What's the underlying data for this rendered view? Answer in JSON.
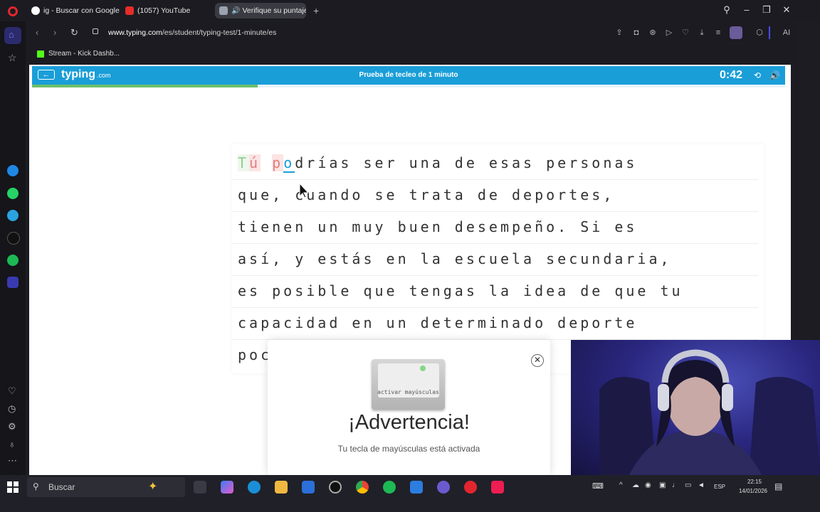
{
  "browser": {
    "tabs": [
      {
        "label": "ig - Buscar con Google",
        "icon": "google-icon"
      },
      {
        "label": "(1057) YouTube",
        "icon": "youtube-icon"
      },
      {
        "label": "Verifique su puntaje d",
        "icon": "speaker-icon"
      }
    ],
    "url_domain": "www.typing.com",
    "url_path": "/es/student/typing-test/1-minute/es",
    "bookmark": "Stream - Kick Dashb...",
    "toolbar_ai": "AI"
  },
  "page": {
    "logo": "typing",
    "logo_suffix": ".com",
    "title": "Prueba de tecleo de 1 minuto",
    "timer": "0:42",
    "progress_fraction": 0.3,
    "lines": [
      "que, cuando se trata de deportes,",
      "tienen un muy buen desempeño. Si es",
      "así, y estás en la escuela secundaria,",
      "es posible que tengas la idea de que tu",
      "capacidad en un determinado deporte",
      "poc"
    ],
    "first_line": {
      "typed_ok": "T",
      "typed_err": "ú",
      "typed_err2": "p",
      "current": "o",
      "prefix_space": " ",
      "rest": "drías ser una de esas personas"
    },
    "warning": {
      "key_label": "activar mayúsculas",
      "title": "¡Advertencia!",
      "message": "Tu tecla de mayúsculas está activada"
    }
  },
  "taskbar": {
    "search_label": "Buscar",
    "lang": "ESP",
    "time": "22:15",
    "date": "14/01/2026"
  },
  "colors": {
    "brand_blue": "#1a9ed8",
    "progress_green": "#6cc06a",
    "error_red": "#e08080"
  }
}
